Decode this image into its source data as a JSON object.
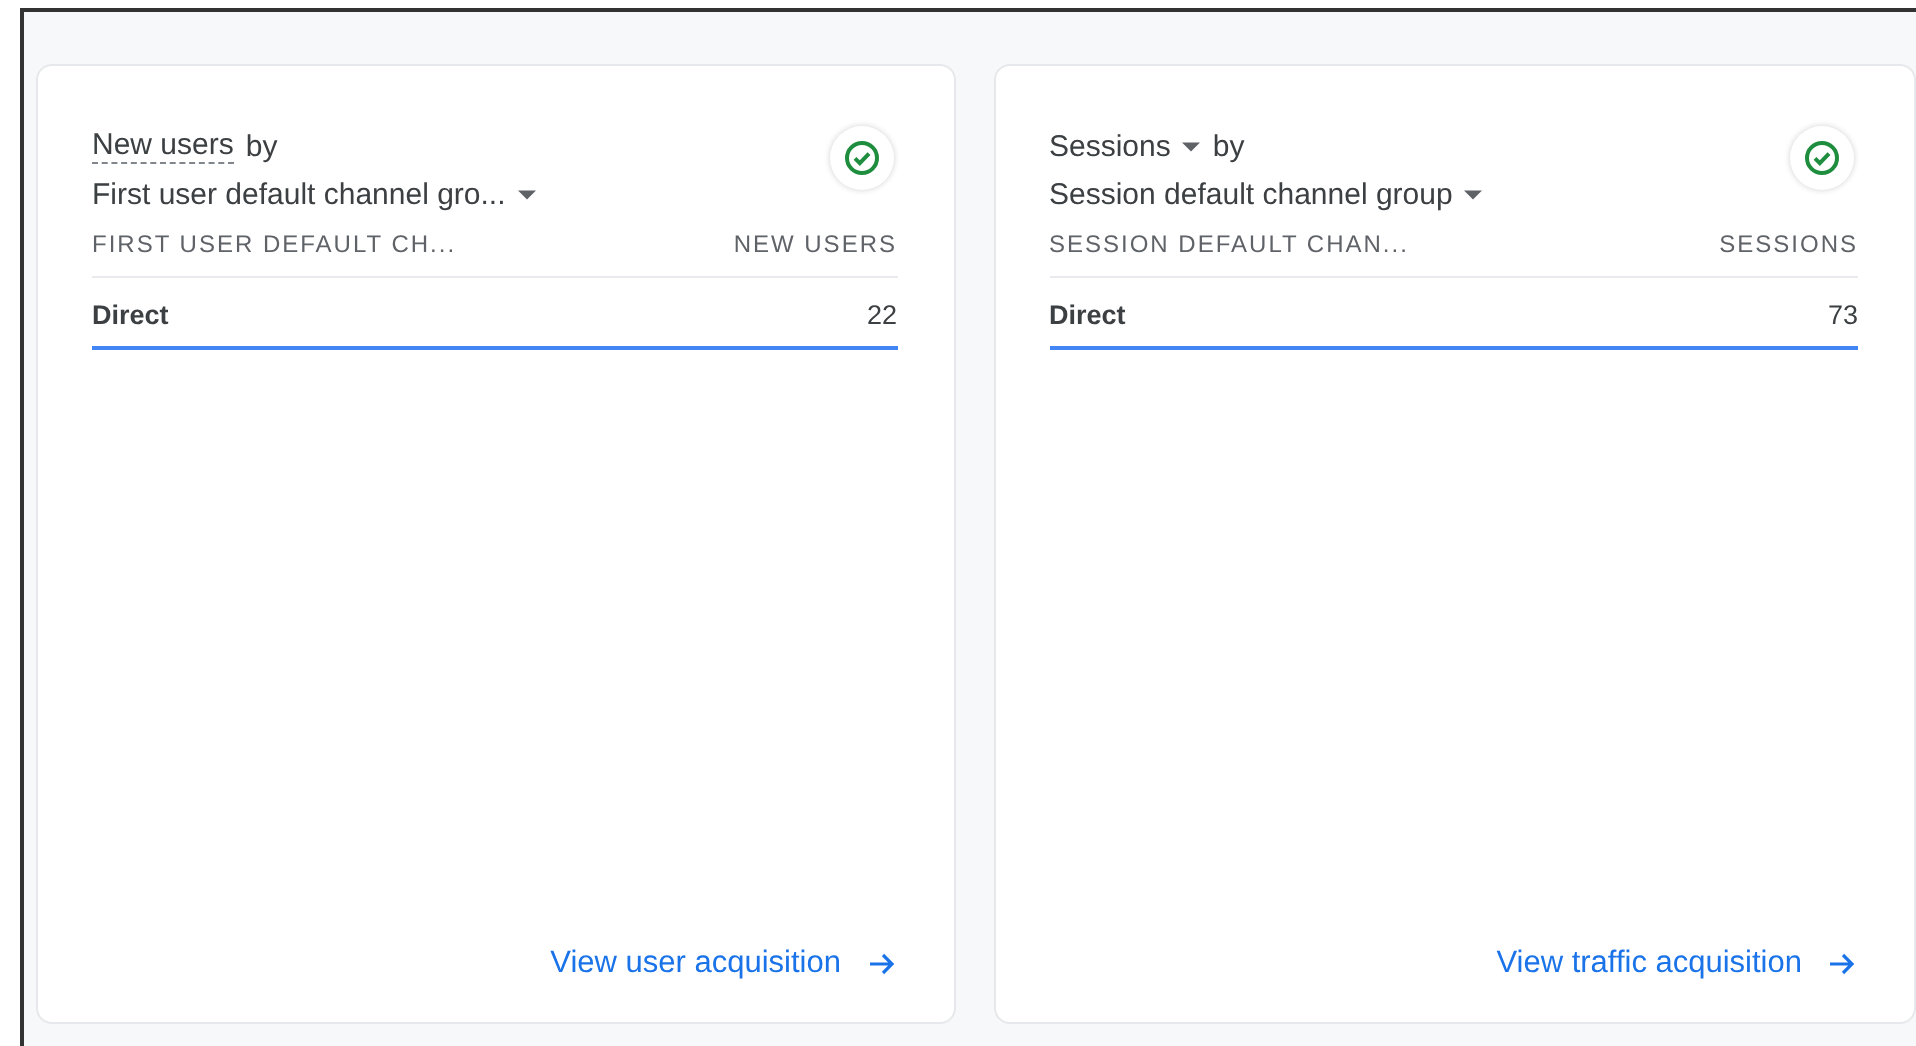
{
  "cards": [
    {
      "metric": "New users",
      "metric_dropdown": false,
      "by": "by",
      "dimension": "First user default channel gro...",
      "verified": true,
      "columns": [
        "FIRST USER DEFAULT CH...",
        "NEW USERS"
      ],
      "rows": [
        {
          "label": "Direct",
          "value": "22"
        }
      ],
      "link": "View user acquisition"
    },
    {
      "metric": "Sessions",
      "metric_dropdown": true,
      "by": "by",
      "dimension": "Session default channel group",
      "verified": true,
      "columns": [
        "SESSION DEFAULT CHAN...",
        "SESSIONS"
      ],
      "rows": [
        {
          "label": "Direct",
          "value": "73"
        }
      ],
      "link": "View traffic acquisition"
    }
  ]
}
